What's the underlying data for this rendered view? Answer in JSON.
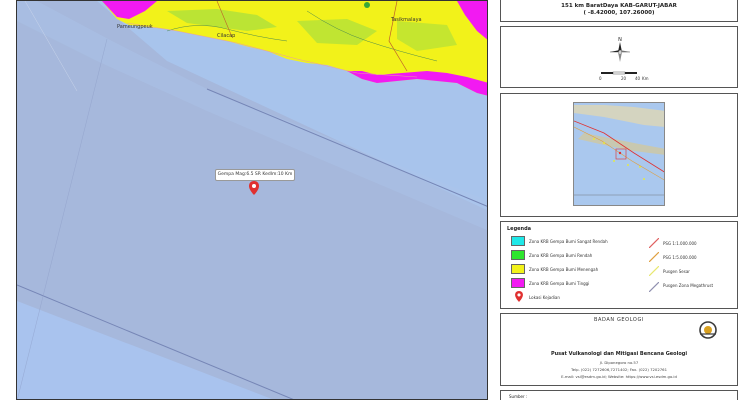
{
  "header": {
    "line1": "151 km BaratDaya KAB-GARUT-JABAR",
    "line2": "( -8.42000, 107.26000)"
  },
  "scale": {
    "ticks": [
      "0",
      "20",
      "40"
    ],
    "unit": "Km"
  },
  "map": {
    "callout": "Gempa Mag:6.5 SR Kedlm:10 Km",
    "place_labels": [
      "Tasikmalaya",
      "Cilacap",
      "Pameungpeuk"
    ]
  },
  "legend": {
    "title": "Legenda",
    "items": [
      {
        "label": "Zona KRB Gempa Bumi Sangat Rendah",
        "color": "#1fe8e8"
      },
      {
        "label": "Zona KRB Gempa Bumi Rendah",
        "color": "#2ee62e"
      },
      {
        "label": "Zona KRB Gempa Bumi Menengah",
        "color": "#f2f21a"
      },
      {
        "label": "Zona KRB Gempa Bumi Tinggi",
        "color": "#f21af2"
      },
      {
        "label": "Lokasi Kejadian",
        "color": "#e03030"
      }
    ],
    "right_items": [
      {
        "label": "PSG 1:1.000.000",
        "color": "#e06060"
      },
      {
        "label": "PSG 1:5.000.000",
        "color": "#e0a040"
      },
      {
        "label": "Pusgen Sesar",
        "color": "#e8e870"
      },
      {
        "label": "Pusgen Zona Megathrust",
        "color": "#9090b0"
      }
    ]
  },
  "agency": {
    "logo_text": "BADAN GEOLOGI",
    "name": "Pusat Vulkanologi dan Mitigasi Bencana Geologi",
    "address": "Jl. Diponegoro no.57",
    "phone": "Telp. (022) 7272606,7271402; Fax. (022) 7202761",
    "email": "E-mail: vsi@esdm.go.id; Website: https://www.vsi.esdm.go.id"
  },
  "source": {
    "title": "Sumber :"
  },
  "colors": {
    "sea": "#a8c4ec",
    "land_yellow": "#f2f21a",
    "land_magenta": "#f21af2",
    "marker": "#e03030"
  }
}
